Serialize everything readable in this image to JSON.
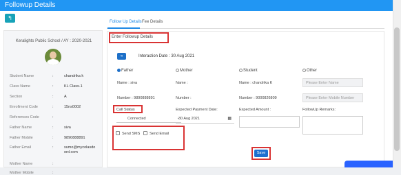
{
  "header": {
    "title": "Followup Details"
  },
  "left": {
    "school": "Keralights Public School / AY : 2020-2021",
    "colon": ":",
    "fields": [
      {
        "label": "Student Name",
        "value": "chandrika k"
      },
      {
        "label": "Class Name",
        "value": "KL Class-1"
      },
      {
        "label": "Section",
        "value": "A"
      },
      {
        "label": "Enrollment Code",
        "value": "15ns0002"
      },
      {
        "label": "References Code",
        "value": ""
      },
      {
        "label": "Father Name",
        "value": "siva"
      },
      {
        "label": "Father Mobile",
        "value": "9890888891"
      },
      {
        "label": "Father Email",
        "value": "sumo@mycolasdoord.com"
      },
      {
        "label": "Mother Name",
        "value": ""
      },
      {
        "label": "Mother Mobile",
        "value": ""
      }
    ]
  },
  "tabs": {
    "followup": "Follow Up Details",
    "fee": "Fee Details"
  },
  "form": {
    "enter_label": "Enter Followup Details",
    "toggle_icon": "«",
    "interaction_date": "Interaction Date : 30 Aug 2021",
    "radios": [
      {
        "label": "Father",
        "checked": true
      },
      {
        "label": "Mother",
        "checked": false
      },
      {
        "label": "Student",
        "checked": false
      },
      {
        "label": "Other",
        "checked": false
      }
    ],
    "names": [
      "Name : siva",
      "Name :",
      "Name : chandrika K"
    ],
    "name_placeholder": "Please Enter Name",
    "numbers": [
      "Number : 9890888891",
      "Number :",
      "Number : 9000826809"
    ],
    "mobile_placeholder": "Please Enter Mobile Number",
    "call_status_label": "Call Status",
    "call_status_value": "Connected",
    "payment_date_label": "Expected Payment Date:",
    "payment_date_value": "30 Aug 2021",
    "amount_label": "Expected Amount :",
    "remarks_label": "FollowUp Remarks:",
    "send_sms": "Send SMS",
    "send_email": "Send Email",
    "save": "Save"
  }
}
